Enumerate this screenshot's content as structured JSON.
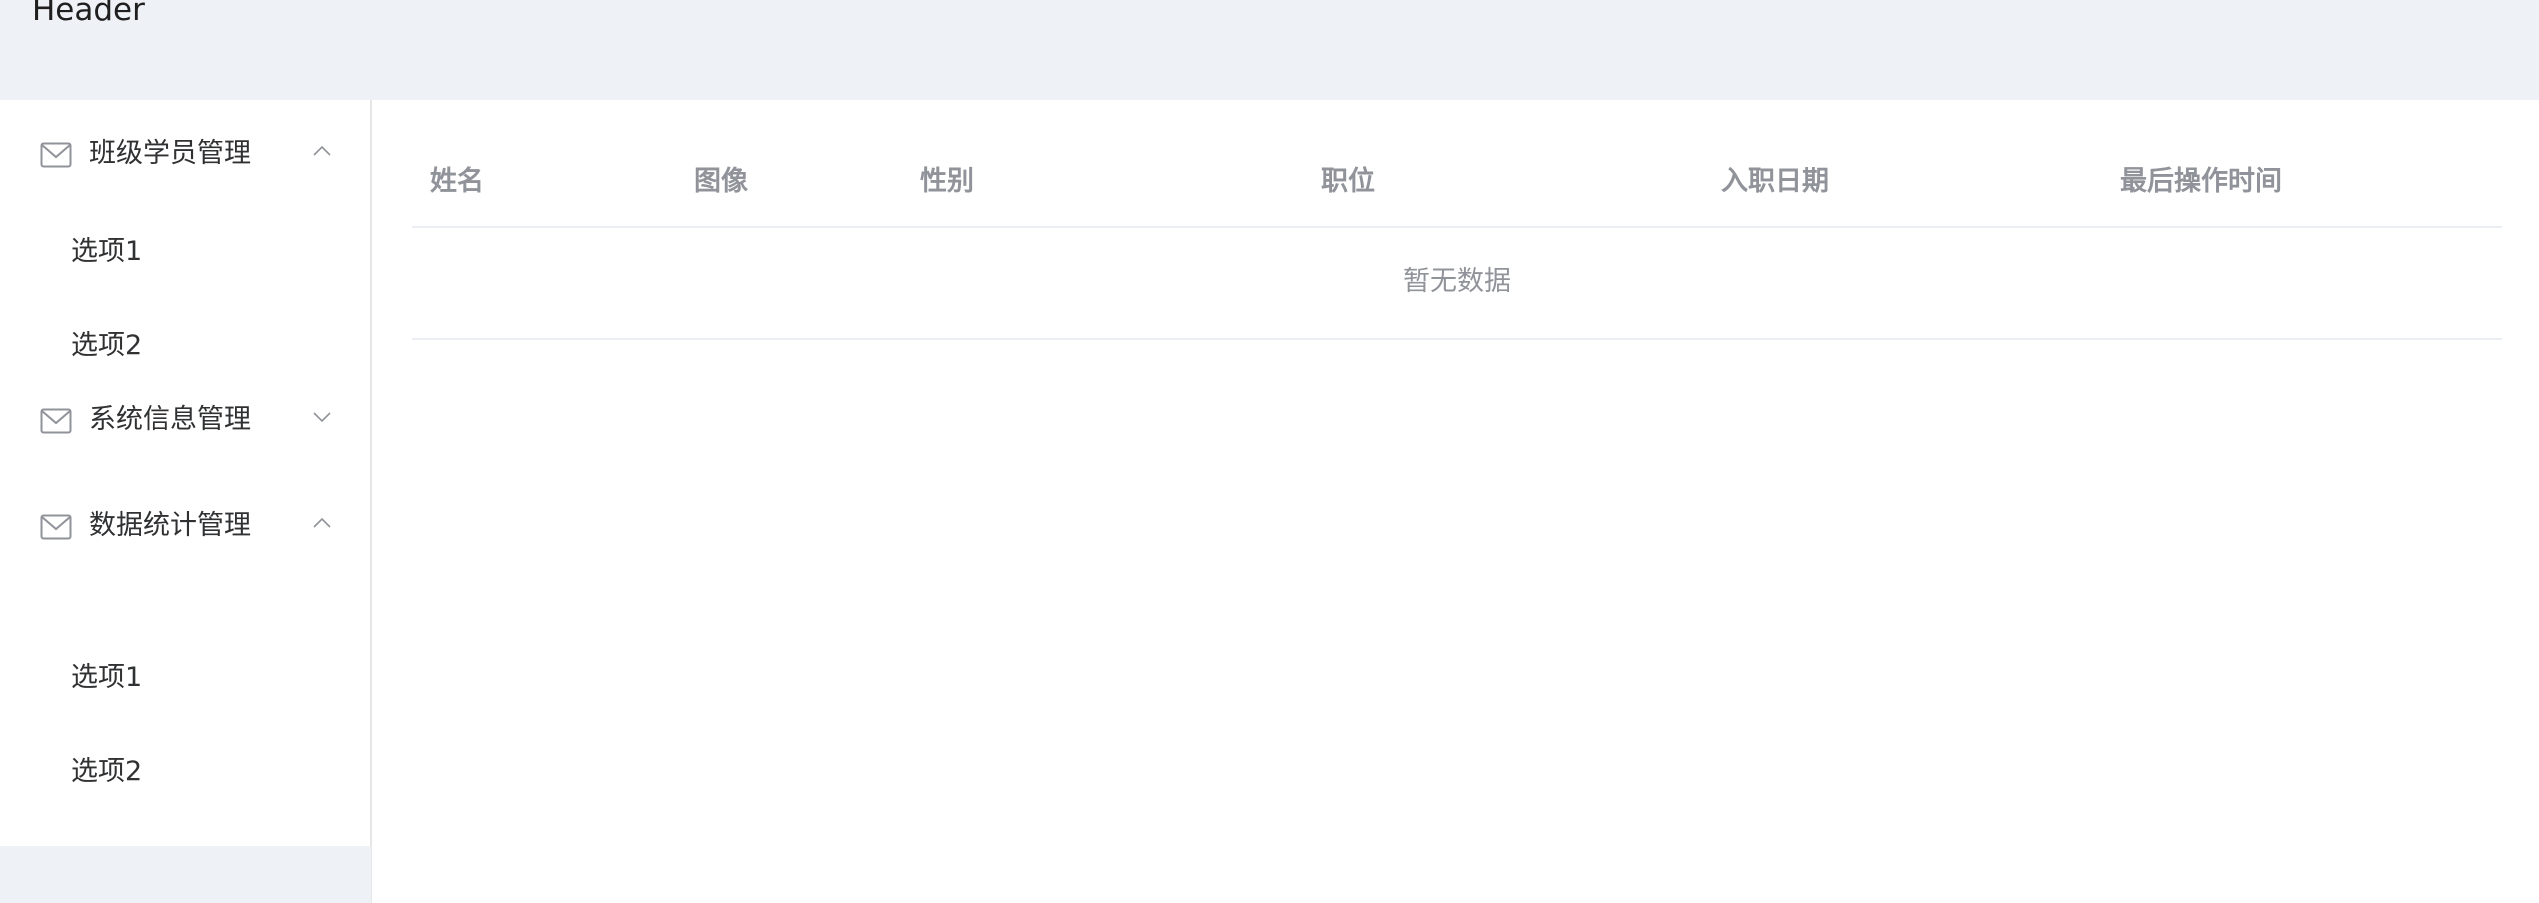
{
  "header": {
    "title": "Header"
  },
  "sidebar": {
    "menus": [
      {
        "label": "班级学员管理",
        "expanded": true,
        "arrow_icon": "chevron-up-icon",
        "icon": "mail-icon",
        "items": [
          {
            "label": "选项1"
          },
          {
            "label": "选项2"
          }
        ]
      },
      {
        "label": "系统信息管理",
        "expanded": false,
        "arrow_icon": "chevron-down-icon",
        "icon": "mail-icon",
        "items": []
      },
      {
        "label": "数据统计管理",
        "expanded": true,
        "arrow_icon": "chevron-up-icon",
        "icon": "mail-icon",
        "items": [
          {
            "label": "选项1"
          },
          {
            "label": "选项2"
          }
        ]
      }
    ]
  },
  "table": {
    "columns": [
      "姓名",
      "图像",
      "性别",
      "职位",
      "入职日期",
      "最后操作时间"
    ],
    "rows": [],
    "empty_text": "暂无数据"
  },
  "colors": {
    "header_bg": "#eef1f6",
    "aside_bg": "#eef1f6",
    "text": "#303133",
    "muted_text": "#909399",
    "border": "#ebeef5"
  }
}
